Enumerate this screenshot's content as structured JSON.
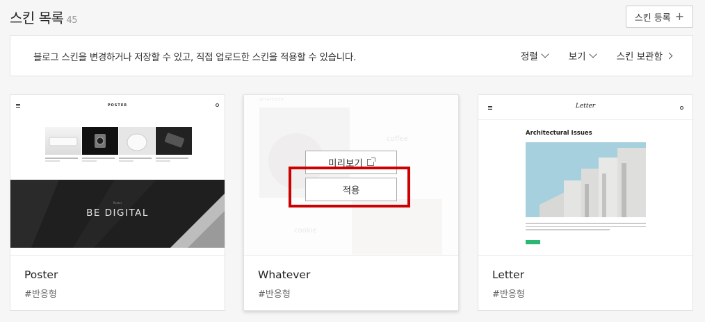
{
  "header": {
    "title": "스킨 목록",
    "count": "45",
    "register_label": "스킨 등록",
    "register_icon": "plus-icon"
  },
  "infobar": {
    "description": "블로그 스킨을 변경하거나 저장할 수 있고, 직접 업로드한 스킨을 적용할 수 있습니다.",
    "sort_label": "정렬",
    "view_label": "보기",
    "storage_label": "스킨 보관함"
  },
  "skins": [
    {
      "name": "Poster",
      "tag": "#반응형",
      "thumb": {
        "logo": "POSTER",
        "banner_kicker": "Poster",
        "banner_text": "BE DIGITAL"
      }
    },
    {
      "name": "Whatever",
      "tag": "#반응형",
      "thumb": {
        "logo": "WHATEVER",
        "word1": "coffee",
        "word2": "cookie"
      },
      "preview_label": "미리보기",
      "apply_label": "적용"
    },
    {
      "name": "Letter",
      "tag": "#반응형",
      "thumb": {
        "logo": "Letter",
        "heading": "Architectural Issues"
      }
    }
  ],
  "colors": {
    "highlight": "#cc0000",
    "accent_green": "#2bb673"
  }
}
